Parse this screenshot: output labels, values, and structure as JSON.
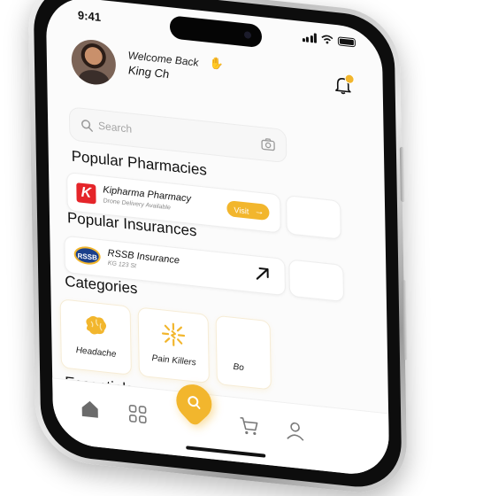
{
  "status_bar": {
    "time": "9:41"
  },
  "header": {
    "welcome": "Welcome Back",
    "username": "King Ch"
  },
  "search": {
    "placeholder": "Search"
  },
  "pharmacies": {
    "title": "Popular Pharmacies",
    "items": [
      {
        "logo_letter": "K",
        "name": "Kipharma Pharmacy",
        "subtitle": "Drone Delivery Available",
        "action": "Visit"
      }
    ]
  },
  "insurances": {
    "title": "Popular Insurances",
    "items": [
      {
        "logo_text": "RSSB",
        "name": "RSSB Insurance",
        "subtitle": "KG 123 St"
      }
    ]
  },
  "categories": {
    "title": "Categories",
    "items": [
      {
        "label": "Headache",
        "icon": "brain-icon"
      },
      {
        "label": "Pain Killers",
        "icon": "pain-burst-icon"
      },
      {
        "label": "Bo",
        "icon": "category-icon"
      }
    ]
  },
  "essentials": {
    "title": "Essentials"
  },
  "tabbar": {
    "items": [
      "home-icon",
      "grid-icon",
      "search-icon",
      "cart-icon",
      "profile-icon"
    ]
  },
  "colors": {
    "accent": "#f2b62d",
    "background": "#fbfbfb",
    "text": "#111111",
    "brand_red": "#e5252a",
    "rssb_blue": "#1a3f8b"
  }
}
